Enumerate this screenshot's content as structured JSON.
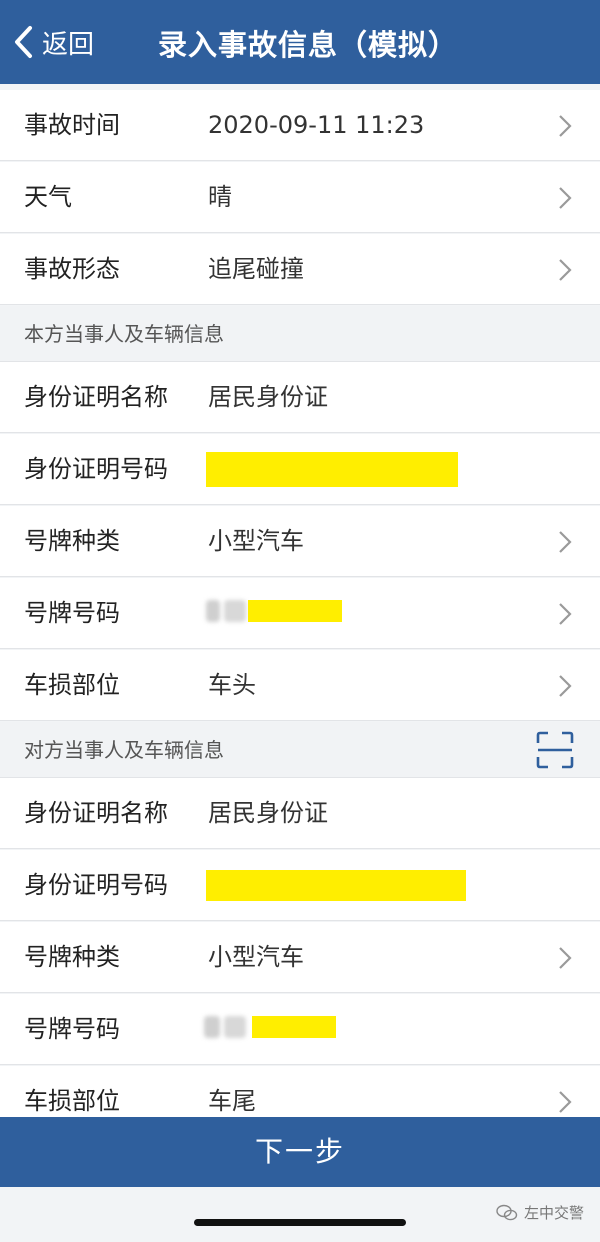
{
  "header": {
    "back_label": "返回",
    "title": "录入事故信息（模拟）"
  },
  "accident": [
    {
      "label": "事故时间",
      "value": "2020-09-11 11:23"
    },
    {
      "label": "天气",
      "value": "晴"
    },
    {
      "label": "事故形态",
      "value": "追尾碰撞"
    }
  ],
  "own_party": {
    "section_title": "本方当事人及车辆信息",
    "id_name_label": "身份证明名称",
    "id_name_value": "居民身份证",
    "id_number_label": "身份证明号码",
    "plate_type_label": "号牌种类",
    "plate_type_value": "小型汽车",
    "plate_number_label": "号牌号码",
    "damage_label": "车损部位",
    "damage_value": "车头"
  },
  "other_party": {
    "section_title": "对方当事人及车辆信息",
    "id_name_label": "身份证明名称",
    "id_name_value": "居民身份证",
    "id_number_label": "身份证明号码",
    "plate_type_label": "号牌种类",
    "plate_type_value": "小型汽车",
    "plate_number_label": "号牌号码",
    "damage_label": "车损部位",
    "damage_value": "车尾"
  },
  "actions": {
    "next_label": "下一步"
  },
  "watermark": {
    "text": "左中交警",
    "icon": "wechat-icon"
  },
  "colors": {
    "brand": "#2f5f9d",
    "redaction": "#ffee00"
  }
}
